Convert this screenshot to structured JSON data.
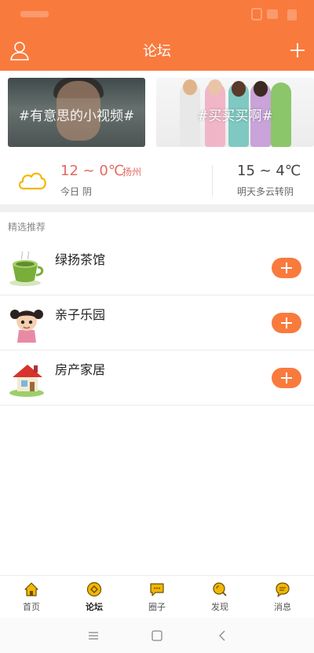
{
  "header": {
    "title": "论坛"
  },
  "banners": [
    {
      "text": "#有意思的小视频#"
    },
    {
      "text": "#买买买啊#"
    }
  ],
  "weather": {
    "today_temp": "12 ~ 0℃",
    "city": "扬州",
    "today_desc": "今日 阴",
    "tomorrow_temp": "15 ~ 4℃",
    "tomorrow_desc": "明天多云转阴"
  },
  "section": {
    "title": "精选推荐"
  },
  "list": [
    {
      "label": "绿扬茶馆",
      "icon": "tea-cup-icon"
    },
    {
      "label": "亲子乐园",
      "icon": "child-icon"
    },
    {
      "label": "房产家居",
      "icon": "house-icon"
    }
  ],
  "tabs": [
    {
      "label": "首页",
      "icon": "home-icon"
    },
    {
      "label": "论坛",
      "icon": "forum-icon"
    },
    {
      "label": "圈子",
      "icon": "chat-bubble-icon"
    },
    {
      "label": "发现",
      "icon": "discover-icon"
    },
    {
      "label": "消息",
      "icon": "message-icon"
    }
  ],
  "colors": {
    "accent": "#f97a3d",
    "tab_icon": "#f2b705",
    "today_temp": "#e26a61"
  }
}
